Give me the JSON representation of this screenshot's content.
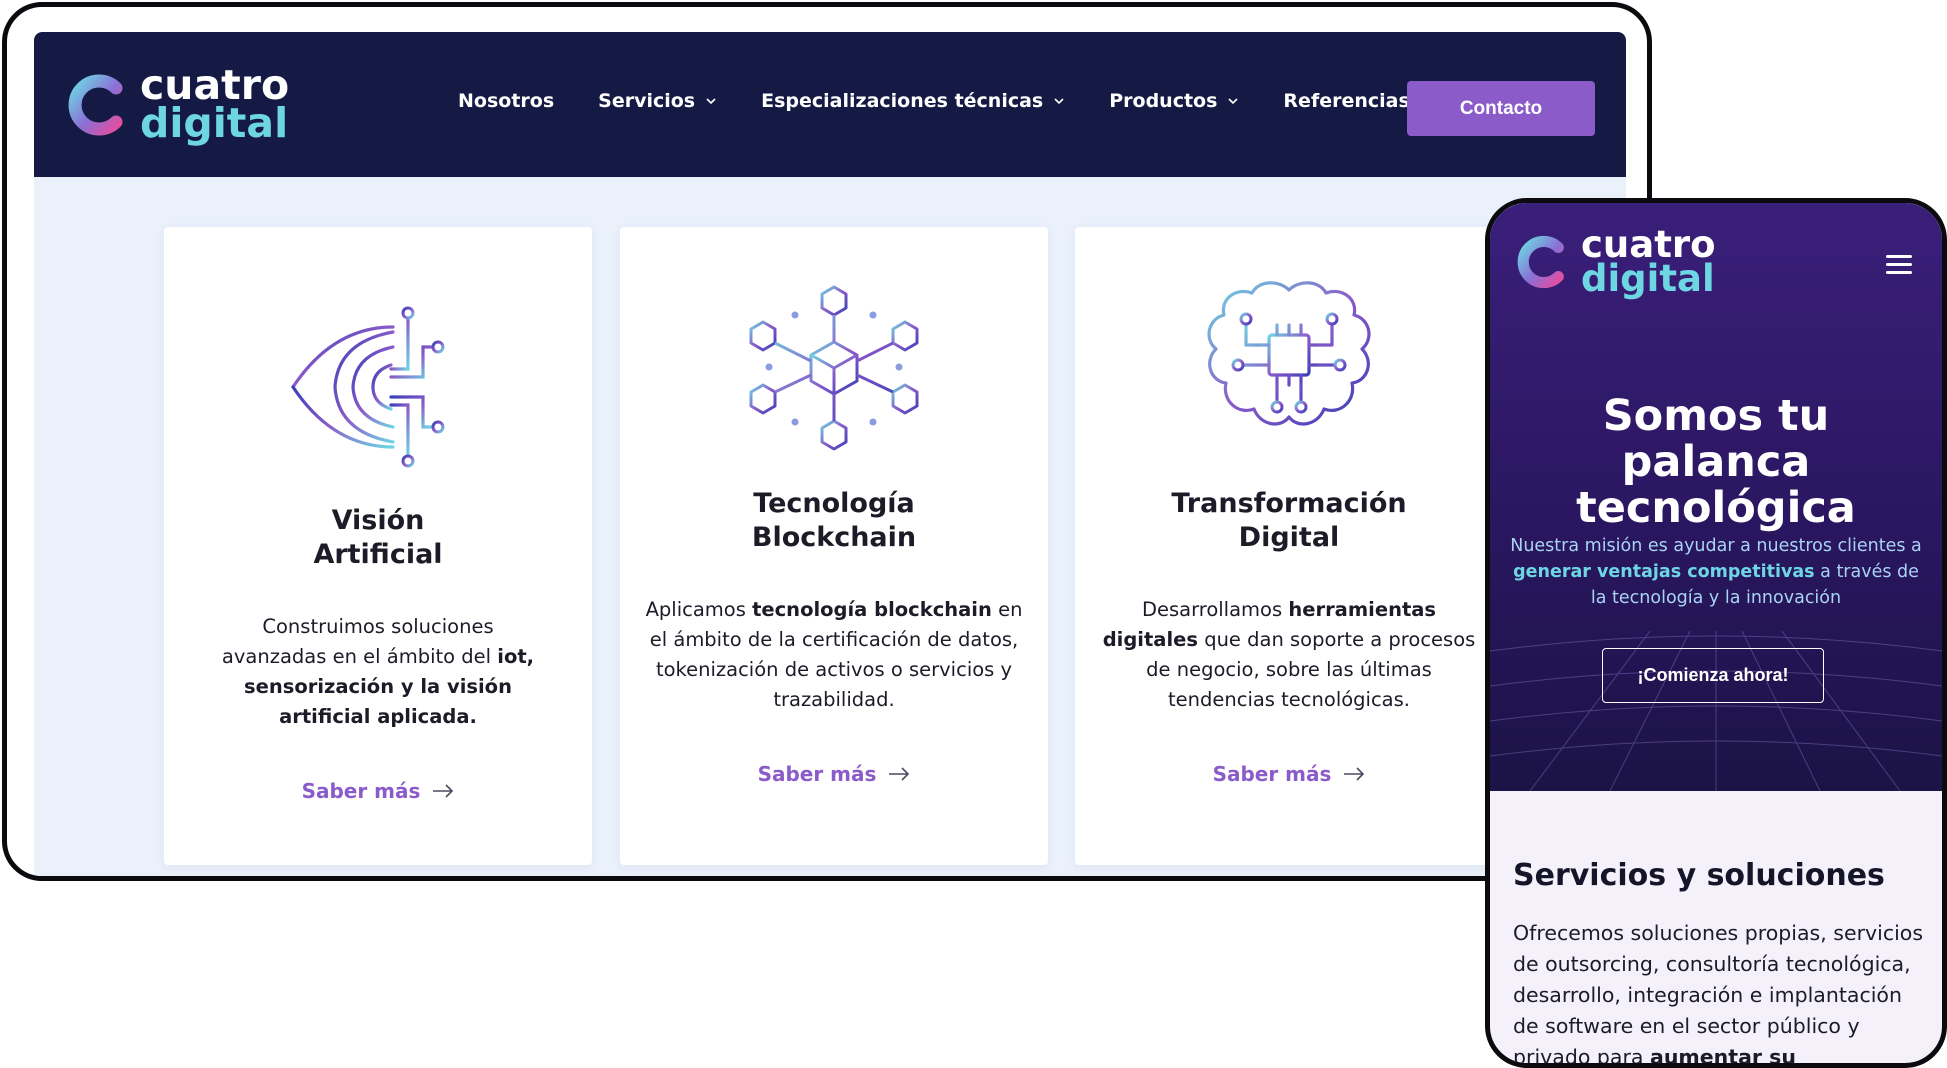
{
  "brand": {
    "name_top": "cuatro",
    "name_bottom": "digital",
    "colors": {
      "navy": "#151a45",
      "purple": "#8a5bc9",
      "cyan": "#6ed6e3",
      "page_bg": "#eaf1fb"
    }
  },
  "desktop": {
    "nav": [
      {
        "label": "Nosotros",
        "dropdown": false
      },
      {
        "label": "Servicios",
        "dropdown": true
      },
      {
        "label": "Especializaciones técnicas",
        "dropdown": true
      },
      {
        "label": "Productos",
        "dropdown": true
      },
      {
        "label": "Referencias",
        "dropdown": false
      }
    ],
    "contact_label": "Contacto",
    "cards": [
      {
        "icon": "eye-circuit-icon",
        "title_line1": "Visión",
        "title_line2": "Artificial",
        "desc_parts": [
          {
            "text": "Construimos soluciones avanzadas en el ámbito del ",
            "bold": false
          },
          {
            "text": "iot, sensorización y la visión artificial aplicada.",
            "bold": true
          }
        ],
        "link": "Saber más"
      },
      {
        "icon": "blockchain-hexagon-icon",
        "title_line1": "Tecnología",
        "title_line2": "Blockchain",
        "desc_parts": [
          {
            "text": "Aplicamos ",
            "bold": false
          },
          {
            "text": "tecnología blockchain",
            "bold": true
          },
          {
            "text": " en el ámbito de la certificación de datos, tokenización de activos o servicios y trazabilidad.",
            "bold": false
          }
        ],
        "link": "Saber más"
      },
      {
        "icon": "brain-chip-icon",
        "title_line1": "Transformación",
        "title_line2": "Digital",
        "desc_parts": [
          {
            "text": "Desarrollamos ",
            "bold": false
          },
          {
            "text": "herramientas digitales",
            "bold": true
          },
          {
            "text": " que dan soporte a procesos de negocio, sobre las últimas tendencias tecnológicas.",
            "bold": false
          }
        ],
        "link": "Saber más"
      }
    ]
  },
  "mobile": {
    "hero_title": "Somos tu palanca tecnológica",
    "hero_sub_parts": [
      {
        "text": "Nuestra misión es ayudar a nuestros clientes a ",
        "bold": false
      },
      {
        "text": "generar ventajas competitivas",
        "bold": true
      },
      {
        "text": " a través de la tecnología y la innovación",
        "bold": false
      }
    ],
    "cta_label": "¡Comienza ahora!",
    "section_title": "Servicios y soluciones",
    "section_body_parts": [
      {
        "text": "Ofrecemos soluciones propias, servicios de outsorcing, consultoría tecnológica, desarrollo, integración e implantación de software en el sector público y privado para ",
        "bold": false
      },
      {
        "text": "aumentar su",
        "bold": true
      }
    ]
  }
}
